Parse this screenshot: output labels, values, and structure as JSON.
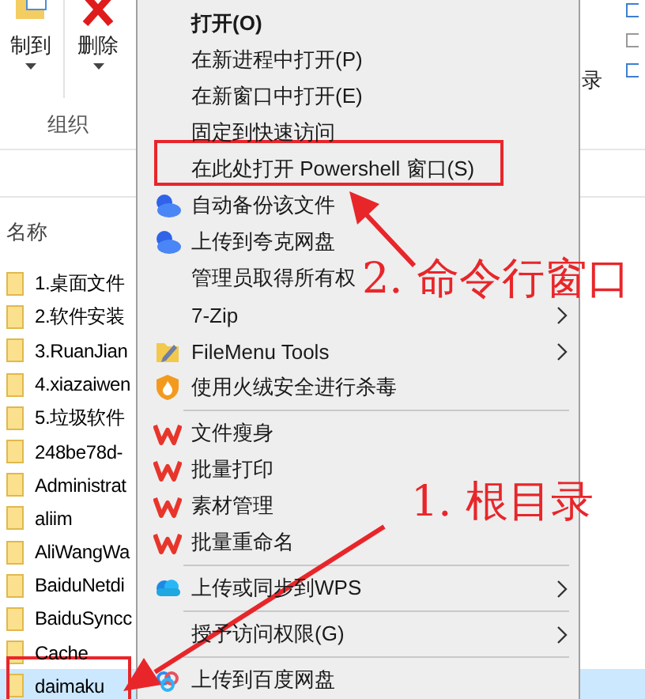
{
  "ribbon": {
    "buttons": [
      {
        "label": "制到",
        "kind": "copy"
      },
      {
        "label": "删除",
        "kind": "delete"
      }
    ],
    "group": "组织",
    "cut_label": "录"
  },
  "file_list": {
    "column": "名称",
    "rows": [
      {
        "name": "1.桌面文件",
        "selected": false
      },
      {
        "name": "2.软件安装",
        "selected": false
      },
      {
        "name": "3.RuanJian",
        "selected": false
      },
      {
        "name": "4.xiazaiwen",
        "selected": false
      },
      {
        "name": "5.垃圾软件",
        "selected": false
      },
      {
        "name": "248be78d-",
        "selected": false
      },
      {
        "name": "Administrat",
        "selected": false
      },
      {
        "name": "aliim",
        "selected": false
      },
      {
        "name": "AliWangWa",
        "selected": false
      },
      {
        "name": "BaiduNetdi",
        "selected": false
      },
      {
        "name": "BaiduSyncc",
        "selected": false
      },
      {
        "name": "Cache",
        "selected": false
      },
      {
        "name": "daimaku",
        "selected": true
      }
    ]
  },
  "context_menu": {
    "items": [
      {
        "kind": "plain",
        "label": "打开(O)",
        "bold": true
      },
      {
        "kind": "plain",
        "label": "在新进程中打开(P)"
      },
      {
        "kind": "plain",
        "label": "在新窗口中打开(E)"
      },
      {
        "kind": "plain",
        "label": "固定到快速访问"
      },
      {
        "kind": "plain",
        "label": "在此处打开 Powershell 窗口(S)"
      },
      {
        "kind": "quark",
        "label": "自动备份该文件"
      },
      {
        "kind": "quark",
        "label": "上传到夸克网盘"
      },
      {
        "kind": "plain",
        "label": "管理员取得所有权"
      },
      {
        "kind": "plain",
        "label": "7-Zip",
        "submenu": true
      },
      {
        "kind": "filemenu",
        "label": "FileMenu Tools",
        "submenu": true
      },
      {
        "kind": "huorong",
        "label": "使用火绒安全进行杀毒"
      },
      {
        "kind": "separator"
      },
      {
        "kind": "wps",
        "label": "文件瘦身"
      },
      {
        "kind": "wps",
        "label": "批量打印"
      },
      {
        "kind": "wps",
        "label": "素材管理"
      },
      {
        "kind": "wps",
        "label": "批量重命名"
      },
      {
        "kind": "separator"
      },
      {
        "kind": "cloud",
        "label": "上传或同步到WPS",
        "submenu": true
      },
      {
        "kind": "separator"
      },
      {
        "kind": "plain",
        "label": "授予访问权限(G)",
        "submenu": true
      },
      {
        "kind": "separator"
      },
      {
        "kind": "baidu",
        "label": "上传到百度网盘"
      }
    ]
  },
  "annotations": [
    {
      "text": "2. 命令行窗口"
    },
    {
      "text": "1. 根目录"
    }
  ]
}
